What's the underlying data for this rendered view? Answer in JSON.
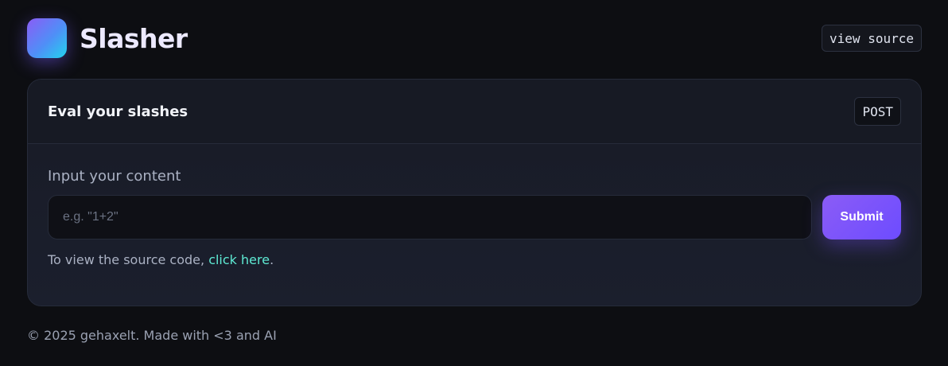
{
  "header": {
    "brand_title": "Slasher",
    "view_source_label": "view source"
  },
  "card": {
    "title": "Eval your slashes",
    "method_badge": "POST",
    "field_label": "Input your content",
    "input": {
      "value": "",
      "placeholder": "e.g. \"1+2\""
    },
    "submit_label": "Submit",
    "source_note_prefix": "To view the source code, ",
    "source_link_label": "click here",
    "source_note_suffix": "."
  },
  "footer": {
    "text": "© 2025 gehaxelt. Made with <3 and AI"
  },
  "colors": {
    "background": "#0d0e12",
    "accent": "#8b5cf6",
    "link": "#5eead4"
  },
  "icons": {
    "logo": "gradient-square-logo"
  }
}
